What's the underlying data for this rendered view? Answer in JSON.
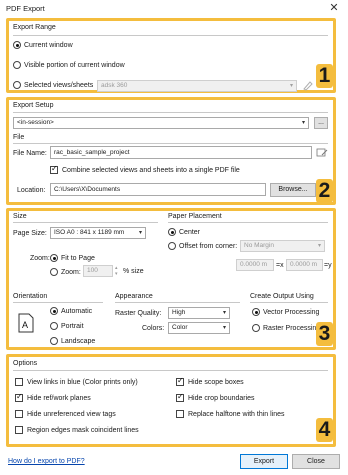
{
  "window": {
    "title": "PDF Export",
    "close_glyph": "✕"
  },
  "badges": [
    "1",
    "2",
    "3",
    "4"
  ],
  "export_range": {
    "heading": "Export Range",
    "options": [
      "Current window",
      "Visible portion of current window",
      "Selected views/sheets"
    ],
    "selected_index": 0,
    "views_dropdown": "adsk 360"
  },
  "export_setup": {
    "heading": "Export Setup",
    "setup_value": "<in-session>",
    "more_button": "...",
    "file_heading": "File",
    "file_name_label": "File Name:",
    "file_name_value": "rac_basic_sample_project",
    "combine_label": "Combine selected views and sheets into a single PDF file",
    "combine_checked": true,
    "location_label": "Location:",
    "location_value": "C:\\Users\\X\\Documents",
    "browse_button": "Browse..."
  },
  "size": {
    "heading": "Size",
    "page_size_label": "Page Size:",
    "page_size_value": "ISO A0 : 841 x 1189 mm",
    "zoom_label": "Zoom:",
    "fit_label": "Fit to Page",
    "zoom_option_label": "Zoom:",
    "zoom_value": "100",
    "zoom_unit": "% size"
  },
  "paper_placement": {
    "heading": "Paper Placement",
    "center_label": "Center",
    "offset_label": "Offset from corner:",
    "offset_dropdown": "No Margin",
    "x_value": "0.0000 m",
    "x_suffix": "=x",
    "y_value": "0.0000 m",
    "y_suffix": "=y"
  },
  "orientation": {
    "heading": "Orientation",
    "options": [
      "Automatic",
      "Portrait",
      "Landscape"
    ],
    "selected_index": 0
  },
  "appearance": {
    "heading": "Appearance",
    "raster_label": "Raster Quality:",
    "raster_value": "High",
    "colors_label": "Colors:",
    "colors_value": "Color"
  },
  "output": {
    "heading": "Create Output Using",
    "options": [
      "Vector Processing",
      "Raster Processing"
    ],
    "selected_index": 0
  },
  "options": {
    "heading": "Options",
    "left": [
      {
        "label": "View links in blue (Color prints only)",
        "checked": false
      },
      {
        "label": "Hide ref/work planes",
        "checked": true
      },
      {
        "label": "Hide unreferenced view tags",
        "checked": false
      },
      {
        "label": "Region edges mask coincident lines",
        "checked": false
      }
    ],
    "right": [
      {
        "label": "Hide scope boxes",
        "checked": true
      },
      {
        "label": "Hide crop boundaries",
        "checked": true
      },
      {
        "label": "Replace halftone with thin lines",
        "checked": false
      }
    ]
  },
  "footer": {
    "help_link": "How do I export to PDF?",
    "export_button": "Export",
    "close_button": "Close"
  },
  "colors": {
    "highlight": "#f4bd3e",
    "link": "#0645ad",
    "primary_border": "#0078d7"
  }
}
